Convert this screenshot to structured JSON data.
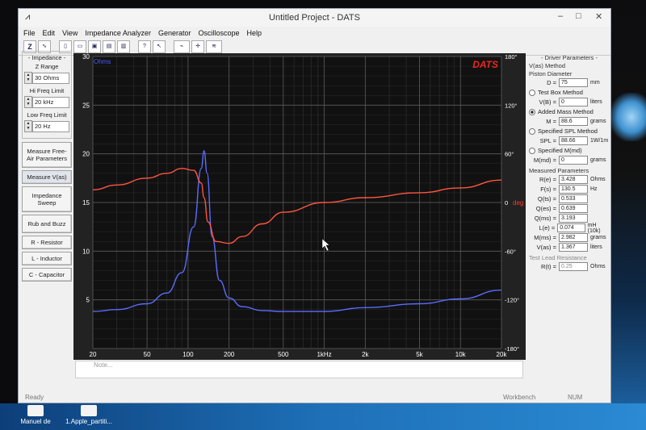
{
  "window": {
    "title": "Untitled Project - DATS",
    "controls": [
      "–",
      "□",
      "✕"
    ]
  },
  "menu": [
    "File",
    "Edit",
    "View",
    "Impedance Analyzer",
    "Generator",
    "Oscilloscope",
    "Help"
  ],
  "left_panel": {
    "impedance_header": "- Impedance -",
    "z_range_label": "Z Range",
    "z_range_value": "30 Ohms",
    "hi_freq_label": "Hi Freq Limit",
    "hi_freq_value": "20 kHz",
    "low_freq_label": "Low Freq Limit",
    "low_freq_value": "20 Hz",
    "buttons": [
      "Measure Free-Air Parameters",
      "Measure V(as)",
      "Impedance Sweep",
      "Rub and Buzz",
      "R - Resistor",
      "L - Inductor",
      "C - Capacitor"
    ]
  },
  "right_panel": {
    "header": "- Driver Parameters -",
    "method_label": "V(as) Method",
    "piston_label": "Piston Diameter",
    "d_key": "D =",
    "d_value": "75",
    "d_unit": "mm",
    "test_box": "Test Box Method",
    "vb_key": "V(B) =",
    "vb_value": "0",
    "vb_unit": "liters",
    "added_mass": "Added Mass Method",
    "m_key": "M =",
    "m_value": "88.6",
    "m_unit": "grams",
    "spl_method": "Specified SPL Method",
    "spl_key": "SPL =",
    "spl_value": "88.66",
    "spl_unit": "1W/1m",
    "mmd_method": "Specified M(md)",
    "mmd_key": "M(md) =",
    "mmd_value": "0",
    "mmd_unit": "grams",
    "measured_header": "Measured Parameters",
    "params": [
      {
        "k": "R(e) =",
        "v": "3.428",
        "u": "Ohms"
      },
      {
        "k": "F(s) =",
        "v": "130.5",
        "u": "Hz"
      },
      {
        "k": "Q(ts) =",
        "v": "0.533",
        "u": ""
      },
      {
        "k": "Q(es) =",
        "v": "0.639",
        "u": ""
      },
      {
        "k": "Q(ms) =",
        "v": "3.193",
        "u": ""
      },
      {
        "k": "L(e) =",
        "v": "0.074",
        "u": "mH (10k)"
      },
      {
        "k": "M(ms) =",
        "v": "2.982",
        "u": "grams"
      },
      {
        "k": "V(as) =",
        "v": "1.367",
        "u": "liters"
      }
    ],
    "test_lead_label": "Test Lead Resistance",
    "rt_key": "R(t) =",
    "rt_value": "0.25",
    "rt_unit": "Ohms"
  },
  "notes_placeholder": "Note...",
  "status": {
    "left": "Ready",
    "mid": "Workbench",
    "right": "NUM"
  },
  "desktop_icons": [
    "Manuel de",
    "1.Apple_partiti..."
  ],
  "colors": {
    "impedance": "#5a6cff",
    "phase": "#ff5540",
    "plot_bg": "#111111",
    "ohms_text": "#4a5cff",
    "deg_text": "#ff3a2a",
    "brand": "#e8281c"
  },
  "chart_data": {
    "type": "line",
    "brand_label": "DATS",
    "x_scale": "log",
    "xlim": [
      20,
      20000
    ],
    "x_ticks": [
      20,
      50,
      100,
      200,
      500,
      1000,
      2000,
      5000,
      10000,
      20000
    ],
    "x_tick_labels": [
      "20",
      "50",
      "100",
      "200",
      "500",
      "1kHz",
      "2k",
      "5k",
      "10k",
      "20k"
    ],
    "left_axis": {
      "unit": "Ohms",
      "ylim": [
        0,
        30
      ],
      "ticks": [
        0,
        5,
        10,
        15,
        20,
        25,
        30
      ],
      "tick_labels": [
        "",
        "5",
        "10",
        "15",
        "20",
        "25",
        "30"
      ]
    },
    "right_axis": {
      "unit": "deg",
      "ylim": [
        -180,
        180
      ],
      "ticks": [
        -180,
        -120,
        -60,
        0,
        60,
        120,
        180
      ],
      "tick_labels": [
        "-180°",
        "-120°",
        "-60°",
        "0",
        "60°",
        "120°",
        "180°"
      ]
    },
    "grid": true,
    "series": [
      {
        "color": "#5a6cff",
        "axis": "left",
        "x": [
          20,
          30,
          50,
          70,
          90,
          110,
          125,
          131,
          138,
          150,
          170,
          200,
          250,
          350,
          500,
          1000,
          2000,
          5000,
          10000,
          20000
        ],
        "y": [
          3.8,
          4.0,
          4.6,
          5.7,
          7.8,
          12.5,
          18.5,
          20.3,
          18.0,
          11.5,
          7.0,
          5.2,
          4.3,
          3.9,
          3.8,
          3.8,
          4.2,
          4.6,
          5.1,
          6.0
        ]
      },
      {
        "color": "#ff5540",
        "axis": "left",
        "x": [
          20,
          30,
          50,
          70,
          90,
          110,
          125,
          131,
          140,
          160,
          200,
          250,
          350,
          500,
          1000,
          2000,
          5000,
          10000,
          20000
        ],
        "y": [
          16.3,
          16.8,
          17.5,
          18.0,
          18.5,
          18.3,
          17.0,
          15.5,
          13.0,
          11.0,
          10.8,
          11.5,
          12.8,
          14.0,
          15.0,
          15.5,
          16.0,
          16.5,
          17.3
        ]
      }
    ]
  }
}
